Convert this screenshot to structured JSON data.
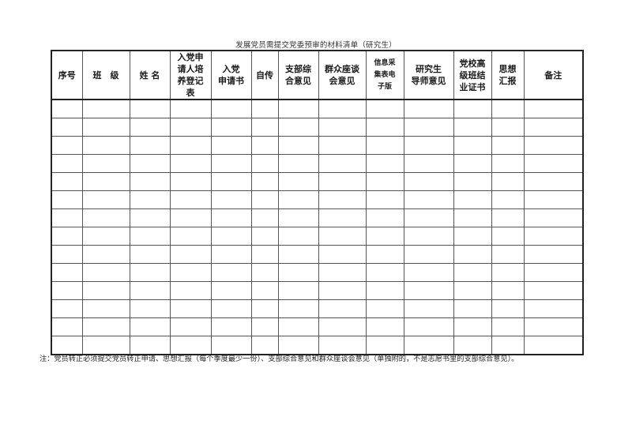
{
  "document": {
    "title": "发展党员需提交党委预审的材料清单（研究生）",
    "note": "注：党员转正必须提交党员转正申请、思想汇报（每个季度最少一份）、支部综合意见和群众座谈会意见（单独附的，不是志愿书里的支部综合意见）。"
  },
  "table": {
    "headers": [
      {
        "key": "seq",
        "label": "序号"
      },
      {
        "key": "class",
        "label": "班　级"
      },
      {
        "key": "name",
        "label": "姓 名"
      },
      {
        "key": "training_form",
        "label": "入党申\n请人培\n养登记\n表"
      },
      {
        "key": "application",
        "label": "入党\n申请书"
      },
      {
        "key": "autobiography",
        "label": "自传"
      },
      {
        "key": "branch_opinion",
        "label": "支部综\n合意见"
      },
      {
        "key": "mass_opinion",
        "label": "群众座谈\n会意见"
      },
      {
        "key": "info_form",
        "label": "信息采\n集表电\n子版"
      },
      {
        "key": "supervisor_opinion",
        "label": "研究生\n导师意见"
      },
      {
        "key": "party_school_cert",
        "label": "党校高\n级班结\n业证书"
      },
      {
        "key": "thought_report",
        "label": "思想\n汇报"
      },
      {
        "key": "remarks",
        "label": "备注"
      }
    ],
    "rows": [
      [
        "",
        "",
        "",
        "",
        "",
        "",
        "",
        "",
        "",
        "",
        "",
        "",
        ""
      ],
      [
        "",
        "",
        "",
        "",
        "",
        "",
        "",
        "",
        "",
        "",
        "",
        "",
        ""
      ],
      [
        "",
        "",
        "",
        "",
        "",
        "",
        "",
        "",
        "",
        "",
        "",
        "",
        ""
      ],
      [
        "",
        "",
        "",
        "",
        "",
        "",
        "",
        "",
        "",
        "",
        "",
        "",
        ""
      ],
      [
        "",
        "",
        "",
        "",
        "",
        "",
        "",
        "",
        "",
        "",
        "",
        "",
        ""
      ],
      [
        "",
        "",
        "",
        "",
        "",
        "",
        "",
        "",
        "",
        "",
        "",
        "",
        ""
      ],
      [
        "",
        "",
        "",
        "",
        "",
        "",
        "",
        "",
        "",
        "",
        "",
        "",
        ""
      ],
      [
        "",
        "",
        "",
        "",
        "",
        "",
        "",
        "",
        "",
        "",
        "",
        "",
        ""
      ],
      [
        "",
        "",
        "",
        "",
        "",
        "",
        "",
        "",
        "",
        "",
        "",
        "",
        ""
      ],
      [
        "",
        "",
        "",
        "",
        "",
        "",
        "",
        "",
        "",
        "",
        "",
        "",
        ""
      ],
      [
        "",
        "",
        "",
        "",
        "",
        "",
        "",
        "",
        "",
        "",
        "",
        "",
        ""
      ],
      [
        "",
        "",
        "",
        "",
        "",
        "",
        "",
        "",
        "",
        "",
        "",
        "",
        ""
      ],
      [
        "",
        "",
        "",
        "",
        "",
        "",
        "",
        "",
        "",
        "",
        "",
        "",
        ""
      ],
      [
        "",
        "",
        "",
        "",
        "",
        "",
        "",
        "",
        "",
        "",
        "",
        "",
        ""
      ]
    ]
  }
}
